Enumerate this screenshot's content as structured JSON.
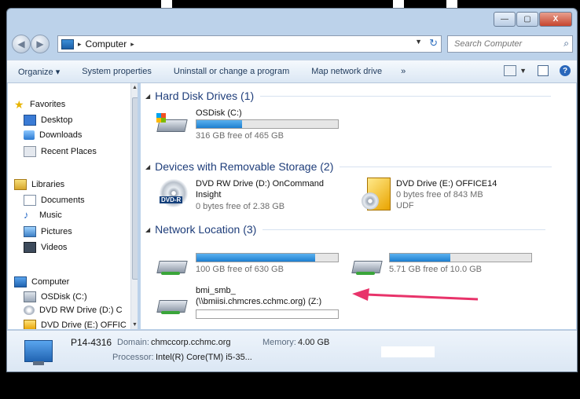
{
  "window": {
    "captions": {
      "minimize": "—",
      "maximize": "▢",
      "close": "X"
    }
  },
  "address": {
    "crumbs": [
      "Computer"
    ],
    "arrow": "▸",
    "search_placeholder": "Search Computer"
  },
  "commands": {
    "items": [
      "Organize ▾",
      "System properties",
      "Uninstall or change a program",
      "Map network drive",
      "»"
    ],
    "help": "?"
  },
  "nav": {
    "favorites": {
      "label": "Favorites",
      "items": [
        "Desktop",
        "Downloads",
        "Recent Places"
      ]
    },
    "libraries": {
      "label": "Libraries",
      "items": [
        "Documents",
        "Music",
        "Pictures",
        "Videos"
      ]
    },
    "computer": {
      "label": "Computer",
      "items": [
        "OSDisk (C:)",
        "DVD RW Drive (D:) C",
        "DVD Drive (E:) OFFIC"
      ]
    }
  },
  "groups": {
    "hdd": {
      "title": "Hard Disk Drives (1)"
    },
    "removable": {
      "title": "Devices with Removable Storage (2)"
    },
    "network": {
      "title": "Network Location (3)"
    }
  },
  "drives": {
    "c": {
      "name": "OSDisk (C:)",
      "free_text": "316 GB free of 465 GB",
      "used_fraction": 0.32
    },
    "d": {
      "name": "DVD RW Drive (D:) OnCommand",
      "name2": "Insight",
      "free_text": "0 bytes free of 2.38 GB",
      "icon_label": "DVD-R"
    },
    "e": {
      "name": "DVD Drive (E:) OFFICE14",
      "free_text": "0 bytes free of 843 MB",
      "fs": "UDF"
    },
    "n1": {
      "free_text": "100 GB free of 630 GB",
      "used_fraction": 0.84
    },
    "n2": {
      "free_text": "5.71 GB free of 10.0 GB",
      "used_fraction": 0.43
    },
    "z": {
      "name": "bmi_smb_",
      "name2": "(\\\\bmiisi.chmcres.cchmc.org) (Z:)",
      "used_fraction": 0.0
    }
  },
  "details": {
    "computer_name": "P14-4316",
    "domain_label": "Domain:",
    "domain": "chmccorp.cchmc.org",
    "memory_label": "Memory:",
    "memory": "4.00 GB",
    "processor_label": "Processor:",
    "processor": "Intel(R) Core(TM) i5-35..."
  },
  "colors": {
    "accent_arrow": "#e8336a",
    "bar_fill": "#1e7fd0"
  }
}
